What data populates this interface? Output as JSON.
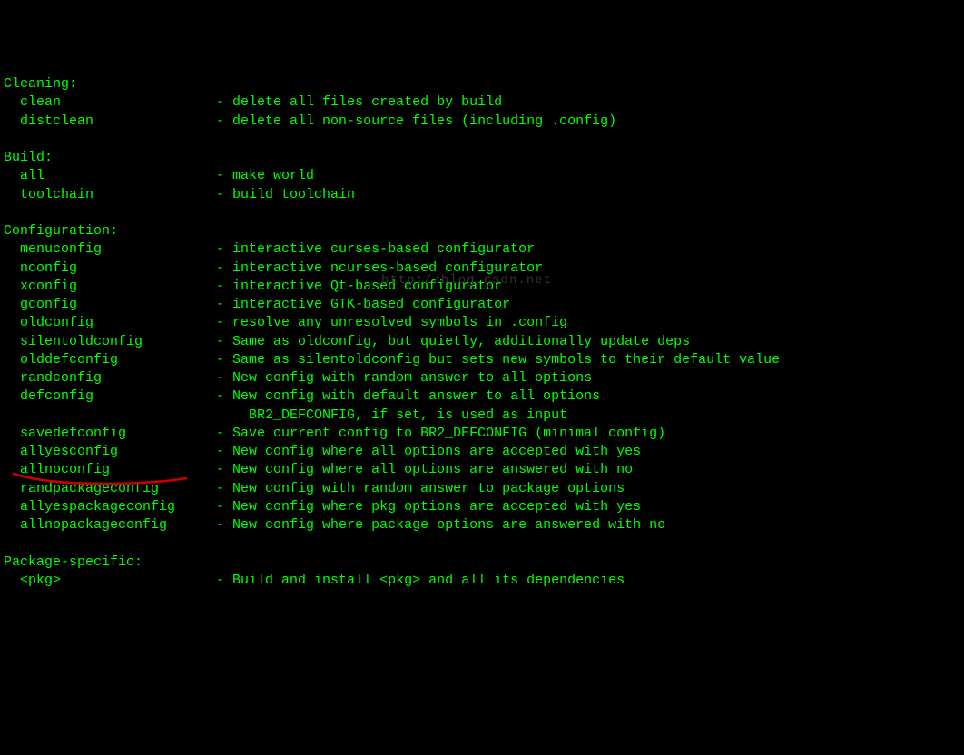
{
  "watermark": "http://blog.csdn.net",
  "sections": {
    "cleaning": {
      "header": "Cleaning:",
      "items": [
        {
          "name": "clean",
          "desc": "- delete all files created by build"
        },
        {
          "name": "distclean",
          "desc": "- delete all non-source files (including .config)"
        }
      ]
    },
    "build": {
      "header": "Build:",
      "items": [
        {
          "name": "all",
          "desc": "- make world"
        },
        {
          "name": "toolchain",
          "desc": "- build toolchain"
        }
      ]
    },
    "configuration": {
      "header": "Configuration:",
      "items": [
        {
          "name": "menuconfig",
          "desc": "- interactive curses-based configurator"
        },
        {
          "name": "nconfig",
          "desc": "- interactive ncurses-based configurator"
        },
        {
          "name": "xconfig",
          "desc": "- interactive Qt-based configurator"
        },
        {
          "name": "gconfig",
          "desc": "- interactive GTK-based configurator"
        },
        {
          "name": "oldconfig",
          "desc": "- resolve any unresolved symbols in .config"
        },
        {
          "name": "silentoldconfig",
          "desc": "- Same as oldconfig, but quietly, additionally update deps"
        },
        {
          "name": "olddefconfig",
          "desc": "- Same as silentoldconfig but sets new symbols to their default value"
        },
        {
          "name": "randconfig",
          "desc": "- New config with random answer to all options"
        },
        {
          "name": "defconfig",
          "desc": "- New config with default answer to all options"
        },
        {
          "name": "",
          "desc": "    BR2_DEFCONFIG, if set, is used as input"
        },
        {
          "name": "savedefconfig",
          "desc": "- Save current config to BR2_DEFCONFIG (minimal config)"
        },
        {
          "name": "allyesconfig",
          "desc": "- New config where all options are accepted with yes"
        },
        {
          "name": "allnoconfig",
          "desc": "- New config where all options are answered with no"
        },
        {
          "name": "randpackageconfig",
          "desc": "- New config with random answer to package options"
        },
        {
          "name": "allyespackageconfig",
          "desc": "- New config where pkg options are accepted with yes"
        },
        {
          "name": "allnopackageconfig",
          "desc": "- New config where package options are answered with no"
        }
      ]
    },
    "package": {
      "header": "Package-specific:",
      "items": [
        {
          "name": "<pkg>",
          "desc": "- Build and install <pkg> and all its dependencies"
        }
      ]
    }
  },
  "layout": {
    "col1_width": 24,
    "indent": 2
  }
}
